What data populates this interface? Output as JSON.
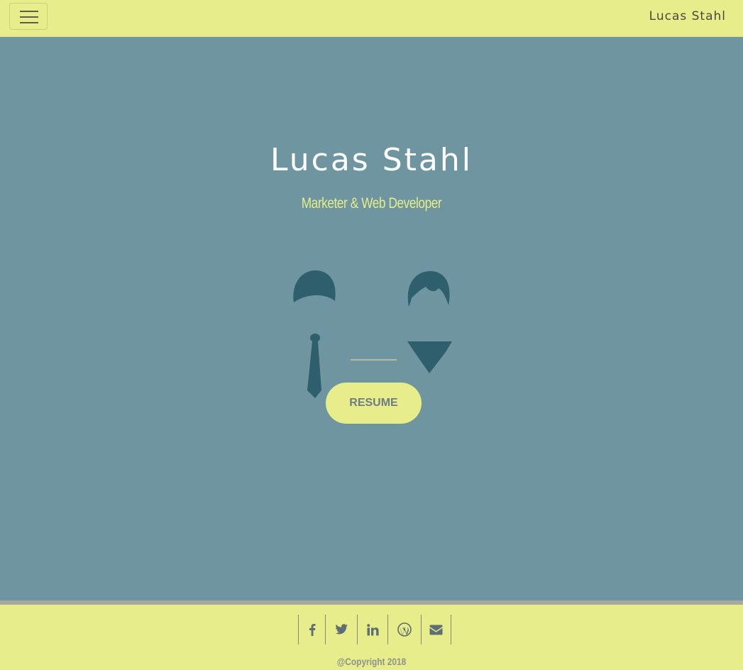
{
  "navbar": {
    "brand": "Lucas Stahl",
    "menu_icon": "hamburger-menu-icon"
  },
  "hero": {
    "title": "Lucas Stahl",
    "subtitle": "Marketer & Web Developer",
    "resume_label": "RESUME"
  },
  "footer": {
    "social": [
      {
        "name": "facebook-icon"
      },
      {
        "name": "twitter-icon"
      },
      {
        "name": "linkedin-icon"
      },
      {
        "name": "wordpress-icon"
      },
      {
        "name": "envelope-icon"
      }
    ],
    "copyright": "@Copyright 2018"
  },
  "colors": {
    "background": "#6f96a0",
    "accent": "#e6ed8a",
    "illustration": "#2f5e6c",
    "footer_text": "#8f9290"
  }
}
